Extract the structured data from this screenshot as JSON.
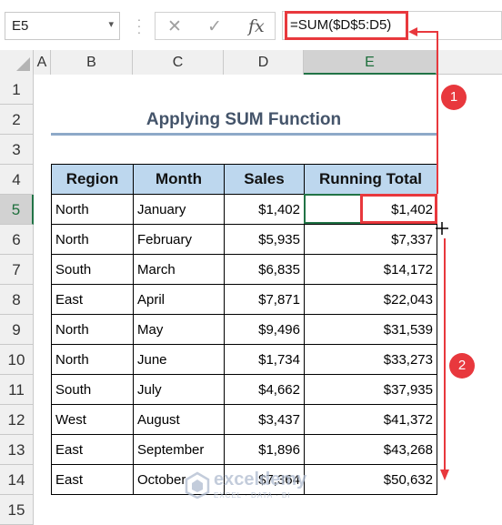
{
  "formula_bar": {
    "name_box": "E5",
    "cancel_icon": "✕",
    "enter_icon": "✓",
    "fx_label": "fx",
    "formula": "=SUM($D$5:D5)"
  },
  "columns": [
    "A",
    "B",
    "C",
    "D",
    "E"
  ],
  "rows": [
    "1",
    "2",
    "3",
    "4",
    "5",
    "6",
    "7",
    "8",
    "9",
    "10",
    "11",
    "12",
    "13",
    "14",
    "15"
  ],
  "sheet": {
    "title": "Applying SUM Function",
    "headers": [
      "Region",
      "Month",
      "Sales",
      "Running Total"
    ],
    "data": [
      [
        "North",
        "January",
        "$1,402",
        "$1,402"
      ],
      [
        "North",
        "February",
        "$5,935",
        "$7,337"
      ],
      [
        "South",
        "March",
        "$6,835",
        "$14,172"
      ],
      [
        "East",
        "April",
        "$7,871",
        "$22,043"
      ],
      [
        "North",
        "May",
        "$9,496",
        "$31,539"
      ],
      [
        "North",
        "June",
        "$1,734",
        "$33,273"
      ],
      [
        "South",
        "July",
        "$4,662",
        "$37,935"
      ],
      [
        "West",
        "August",
        "$3,437",
        "$41,372"
      ],
      [
        "East",
        "September",
        "$1,896",
        "$43,268"
      ],
      [
        "East",
        "October",
        "$7,364",
        "$50,632"
      ]
    ]
  },
  "annotations": {
    "step1": "1",
    "step2": "2",
    "accent": "#e8383d"
  },
  "watermark": {
    "name": "exceldemy",
    "tagline": "EXCEL · DATA · BI"
  }
}
